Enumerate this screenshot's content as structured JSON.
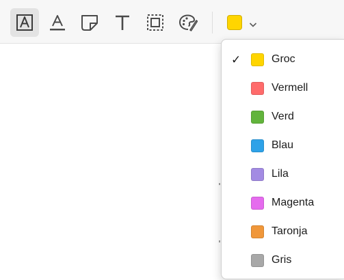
{
  "toolbar": {
    "tools": [
      {
        "name": "text-box-tool",
        "icon": "text-box-icon",
        "active": true
      },
      {
        "name": "text-highlight-tool",
        "icon": "text-underline-icon",
        "active": false
      },
      {
        "name": "sticky-note-tool",
        "icon": "sticky-note-icon",
        "active": false
      },
      {
        "name": "text-tool",
        "icon": "text-t-icon",
        "active": false
      },
      {
        "name": "area-select-tool",
        "icon": "dashed-selection-icon",
        "active": false
      },
      {
        "name": "draw-tool",
        "icon": "palette-pen-icon",
        "active": false
      }
    ],
    "current_color": "#FFD500",
    "color_dropdown_icon": "chevron-down-icon"
  },
  "color_menu": {
    "selected_index": 0,
    "check_glyph": "✓",
    "items": [
      {
        "label": "Groc",
        "color": "#FFD500"
      },
      {
        "label": "Vermell",
        "color": "#FF6B6B"
      },
      {
        "label": "Verd",
        "color": "#62B43C"
      },
      {
        "label": "Blau",
        "color": "#2EA2E8"
      },
      {
        "label": "Lila",
        "color": "#A38BE3"
      },
      {
        "label": "Magenta",
        "color": "#E56BEE"
      },
      {
        "label": "Taronja",
        "color": "#F0973A"
      },
      {
        "label": "Gris",
        "color": "#A8A8A8"
      }
    ]
  }
}
